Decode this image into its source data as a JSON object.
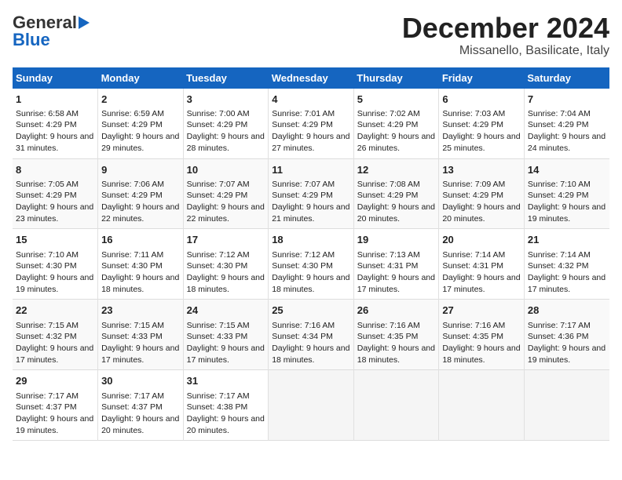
{
  "header": {
    "logo_general": "General",
    "logo_blue": "Blue",
    "month": "December 2024",
    "location": "Missanello, Basilicate, Italy"
  },
  "calendar": {
    "weekdays": [
      "Sunday",
      "Monday",
      "Tuesday",
      "Wednesday",
      "Thursday",
      "Friday",
      "Saturday"
    ],
    "weeks": [
      [
        {
          "day": "1",
          "sunrise": "Sunrise: 6:58 AM",
          "sunset": "Sunset: 4:29 PM",
          "daylight": "Daylight: 9 hours and 31 minutes."
        },
        {
          "day": "2",
          "sunrise": "Sunrise: 6:59 AM",
          "sunset": "Sunset: 4:29 PM",
          "daylight": "Daylight: 9 hours and 29 minutes."
        },
        {
          "day": "3",
          "sunrise": "Sunrise: 7:00 AM",
          "sunset": "Sunset: 4:29 PM",
          "daylight": "Daylight: 9 hours and 28 minutes."
        },
        {
          "day": "4",
          "sunrise": "Sunrise: 7:01 AM",
          "sunset": "Sunset: 4:29 PM",
          "daylight": "Daylight: 9 hours and 27 minutes."
        },
        {
          "day": "5",
          "sunrise": "Sunrise: 7:02 AM",
          "sunset": "Sunset: 4:29 PM",
          "daylight": "Daylight: 9 hours and 26 minutes."
        },
        {
          "day": "6",
          "sunrise": "Sunrise: 7:03 AM",
          "sunset": "Sunset: 4:29 PM",
          "daylight": "Daylight: 9 hours and 25 minutes."
        },
        {
          "day": "7",
          "sunrise": "Sunrise: 7:04 AM",
          "sunset": "Sunset: 4:29 PM",
          "daylight": "Daylight: 9 hours and 24 minutes."
        }
      ],
      [
        {
          "day": "8",
          "sunrise": "Sunrise: 7:05 AM",
          "sunset": "Sunset: 4:29 PM",
          "daylight": "Daylight: 9 hours and 23 minutes."
        },
        {
          "day": "9",
          "sunrise": "Sunrise: 7:06 AM",
          "sunset": "Sunset: 4:29 PM",
          "daylight": "Daylight: 9 hours and 22 minutes."
        },
        {
          "day": "10",
          "sunrise": "Sunrise: 7:07 AM",
          "sunset": "Sunset: 4:29 PM",
          "daylight": "Daylight: 9 hours and 22 minutes."
        },
        {
          "day": "11",
          "sunrise": "Sunrise: 7:07 AM",
          "sunset": "Sunset: 4:29 PM",
          "daylight": "Daylight: 9 hours and 21 minutes."
        },
        {
          "day": "12",
          "sunrise": "Sunrise: 7:08 AM",
          "sunset": "Sunset: 4:29 PM",
          "daylight": "Daylight: 9 hours and 20 minutes."
        },
        {
          "day": "13",
          "sunrise": "Sunrise: 7:09 AM",
          "sunset": "Sunset: 4:29 PM",
          "daylight": "Daylight: 9 hours and 20 minutes."
        },
        {
          "day": "14",
          "sunrise": "Sunrise: 7:10 AM",
          "sunset": "Sunset: 4:29 PM",
          "daylight": "Daylight: 9 hours and 19 minutes."
        }
      ],
      [
        {
          "day": "15",
          "sunrise": "Sunrise: 7:10 AM",
          "sunset": "Sunset: 4:30 PM",
          "daylight": "Daylight: 9 hours and 19 minutes."
        },
        {
          "day": "16",
          "sunrise": "Sunrise: 7:11 AM",
          "sunset": "Sunset: 4:30 PM",
          "daylight": "Daylight: 9 hours and 18 minutes."
        },
        {
          "day": "17",
          "sunrise": "Sunrise: 7:12 AM",
          "sunset": "Sunset: 4:30 PM",
          "daylight": "Daylight: 9 hours and 18 minutes."
        },
        {
          "day": "18",
          "sunrise": "Sunrise: 7:12 AM",
          "sunset": "Sunset: 4:30 PM",
          "daylight": "Daylight: 9 hours and 18 minutes."
        },
        {
          "day": "19",
          "sunrise": "Sunrise: 7:13 AM",
          "sunset": "Sunset: 4:31 PM",
          "daylight": "Daylight: 9 hours and 17 minutes."
        },
        {
          "day": "20",
          "sunrise": "Sunrise: 7:14 AM",
          "sunset": "Sunset: 4:31 PM",
          "daylight": "Daylight: 9 hours and 17 minutes."
        },
        {
          "day": "21",
          "sunrise": "Sunrise: 7:14 AM",
          "sunset": "Sunset: 4:32 PM",
          "daylight": "Daylight: 9 hours and 17 minutes."
        }
      ],
      [
        {
          "day": "22",
          "sunrise": "Sunrise: 7:15 AM",
          "sunset": "Sunset: 4:32 PM",
          "daylight": "Daylight: 9 hours and 17 minutes."
        },
        {
          "day": "23",
          "sunrise": "Sunrise: 7:15 AM",
          "sunset": "Sunset: 4:33 PM",
          "daylight": "Daylight: 9 hours and 17 minutes."
        },
        {
          "day": "24",
          "sunrise": "Sunrise: 7:15 AM",
          "sunset": "Sunset: 4:33 PM",
          "daylight": "Daylight: 9 hours and 17 minutes."
        },
        {
          "day": "25",
          "sunrise": "Sunrise: 7:16 AM",
          "sunset": "Sunset: 4:34 PM",
          "daylight": "Daylight: 9 hours and 18 minutes."
        },
        {
          "day": "26",
          "sunrise": "Sunrise: 7:16 AM",
          "sunset": "Sunset: 4:35 PM",
          "daylight": "Daylight: 9 hours and 18 minutes."
        },
        {
          "day": "27",
          "sunrise": "Sunrise: 7:16 AM",
          "sunset": "Sunset: 4:35 PM",
          "daylight": "Daylight: 9 hours and 18 minutes."
        },
        {
          "day": "28",
          "sunrise": "Sunrise: 7:17 AM",
          "sunset": "Sunset: 4:36 PM",
          "daylight": "Daylight: 9 hours and 19 minutes."
        }
      ],
      [
        {
          "day": "29",
          "sunrise": "Sunrise: 7:17 AM",
          "sunset": "Sunset: 4:37 PM",
          "daylight": "Daylight: 9 hours and 19 minutes."
        },
        {
          "day": "30",
          "sunrise": "Sunrise: 7:17 AM",
          "sunset": "Sunset: 4:37 PM",
          "daylight": "Daylight: 9 hours and 20 minutes."
        },
        {
          "day": "31",
          "sunrise": "Sunrise: 7:17 AM",
          "sunset": "Sunset: 4:38 PM",
          "daylight": "Daylight: 9 hours and 20 minutes."
        },
        null,
        null,
        null,
        null
      ]
    ]
  }
}
